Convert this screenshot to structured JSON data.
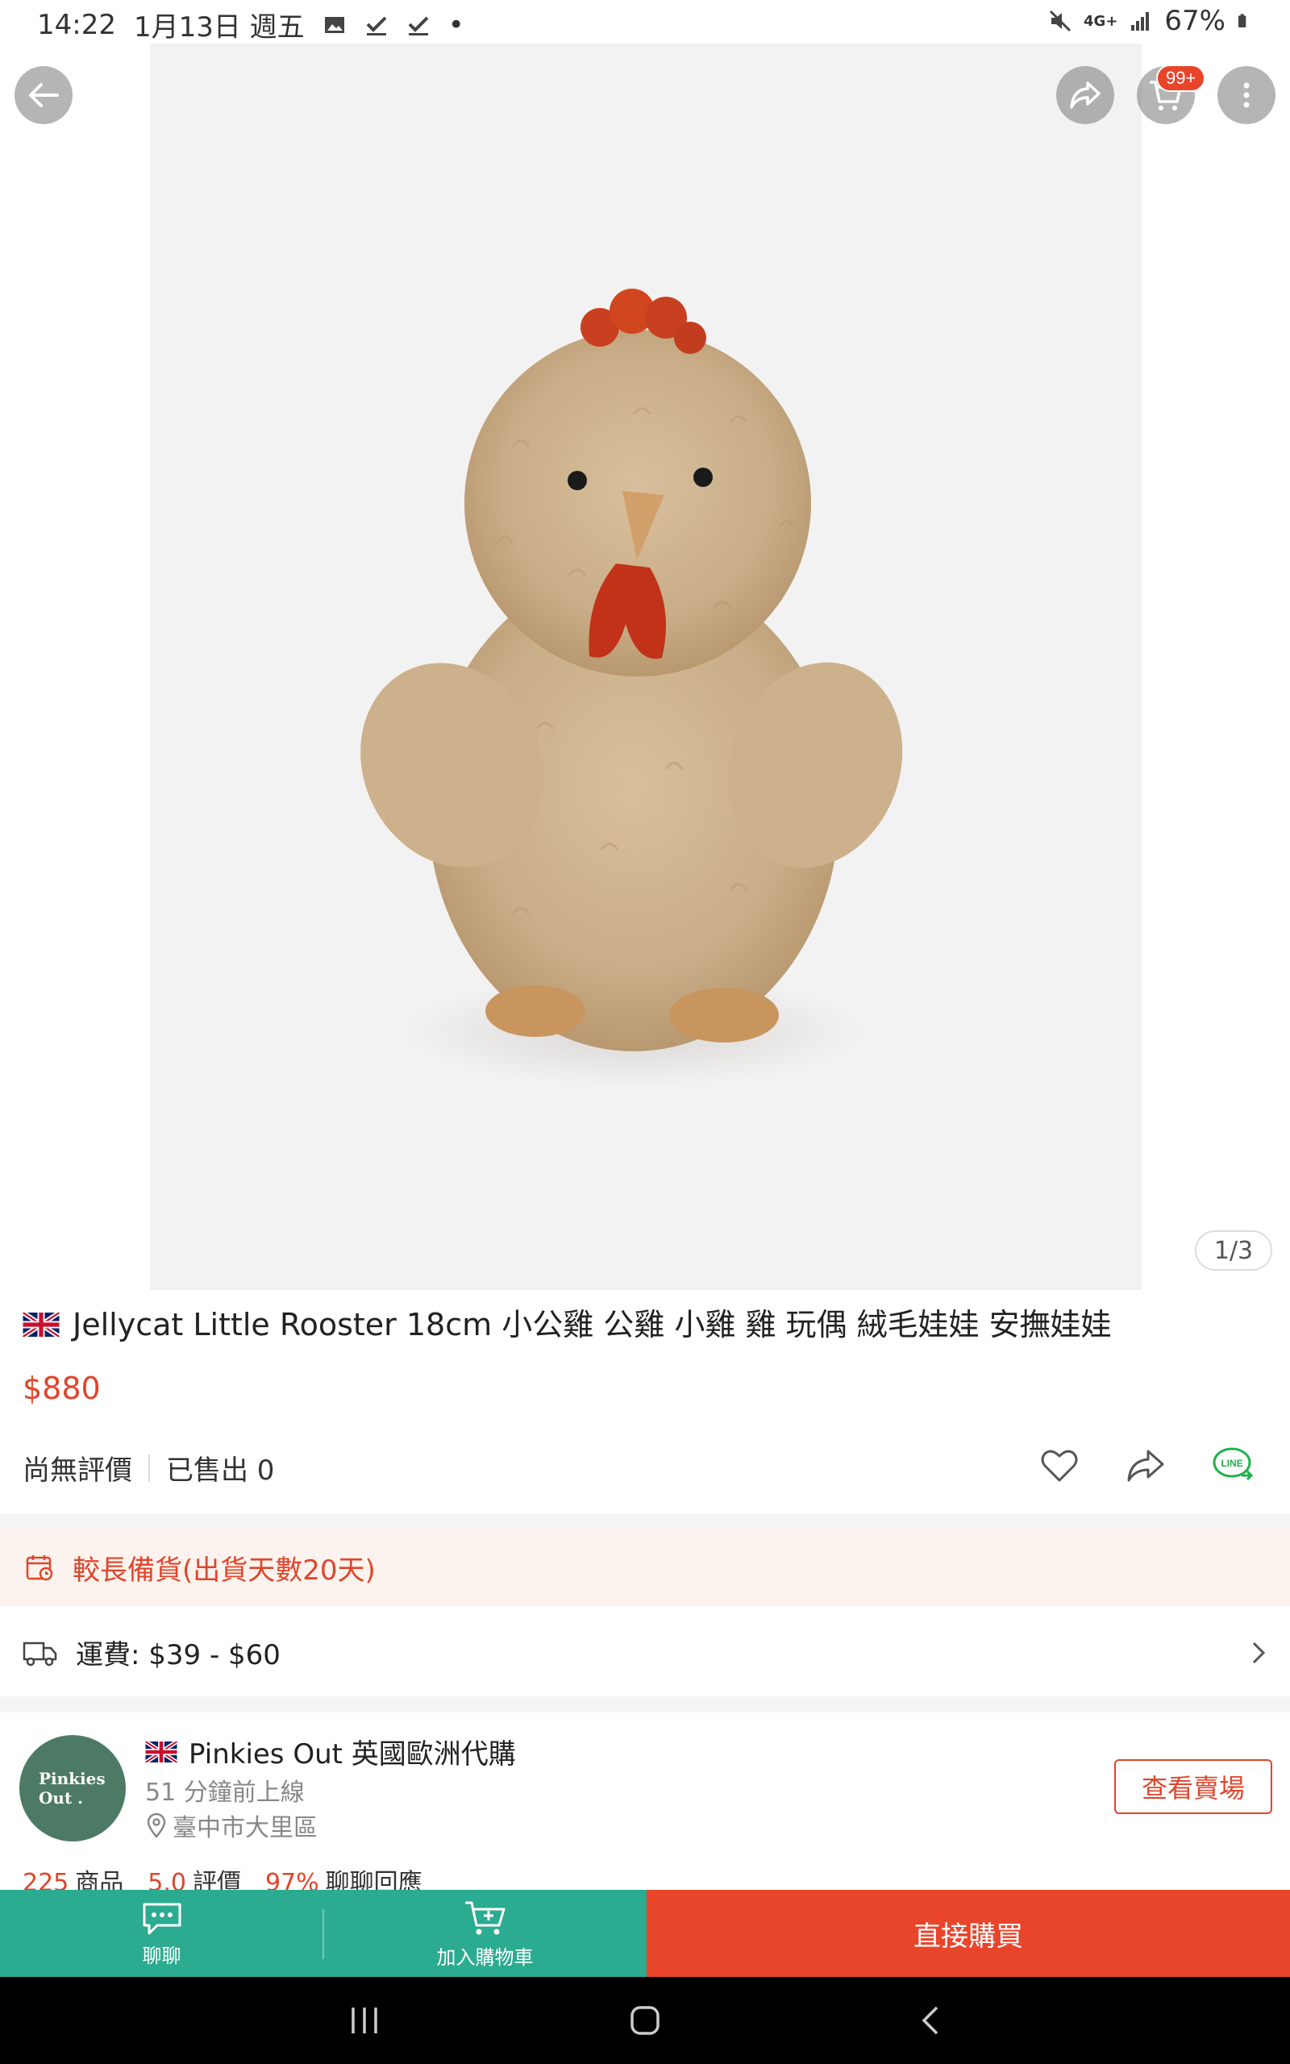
{
  "status_bar": {
    "time": "14:22",
    "date": "1月13日 週五",
    "dot": "•",
    "network": "4G+",
    "battery": "67%"
  },
  "gallery": {
    "counter": "1/3",
    "cart_badge": "99+",
    "product_image_desc": "fluffy beige rooster plush"
  },
  "product": {
    "title": "Jellycat Little Rooster 18cm 小公雞 公雞 小雞 雞 玩偶 絨毛娃娃 安撫娃娃",
    "price": "$880",
    "rating_text": "尚無評價",
    "sold_text": "已售出 0"
  },
  "notice": {
    "text": "較長備貨(出貨天數20天)"
  },
  "shipping": {
    "text": "運費: $39 - $60"
  },
  "shop": {
    "logo_line1": "Pinkies",
    "logo_line2": "Out .",
    "name": "Pinkies Out 英國歐洲代購",
    "online": "51 分鐘前上線",
    "location": "臺中市大里區",
    "view_button": "查看賣場",
    "stats": [
      {
        "num": "225",
        "label": "商品"
      },
      {
        "num": "5.0",
        "label": "評價"
      },
      {
        "num": "97%",
        "label": "聊聊回應"
      }
    ]
  },
  "bottom_bar": {
    "chat_label": "聊聊",
    "cart_label": "加入購物車",
    "buy_label": "直接購買"
  },
  "colors": {
    "accent": "#e0452b",
    "teal": "#2bab8f",
    "buy": "#e8452b"
  }
}
